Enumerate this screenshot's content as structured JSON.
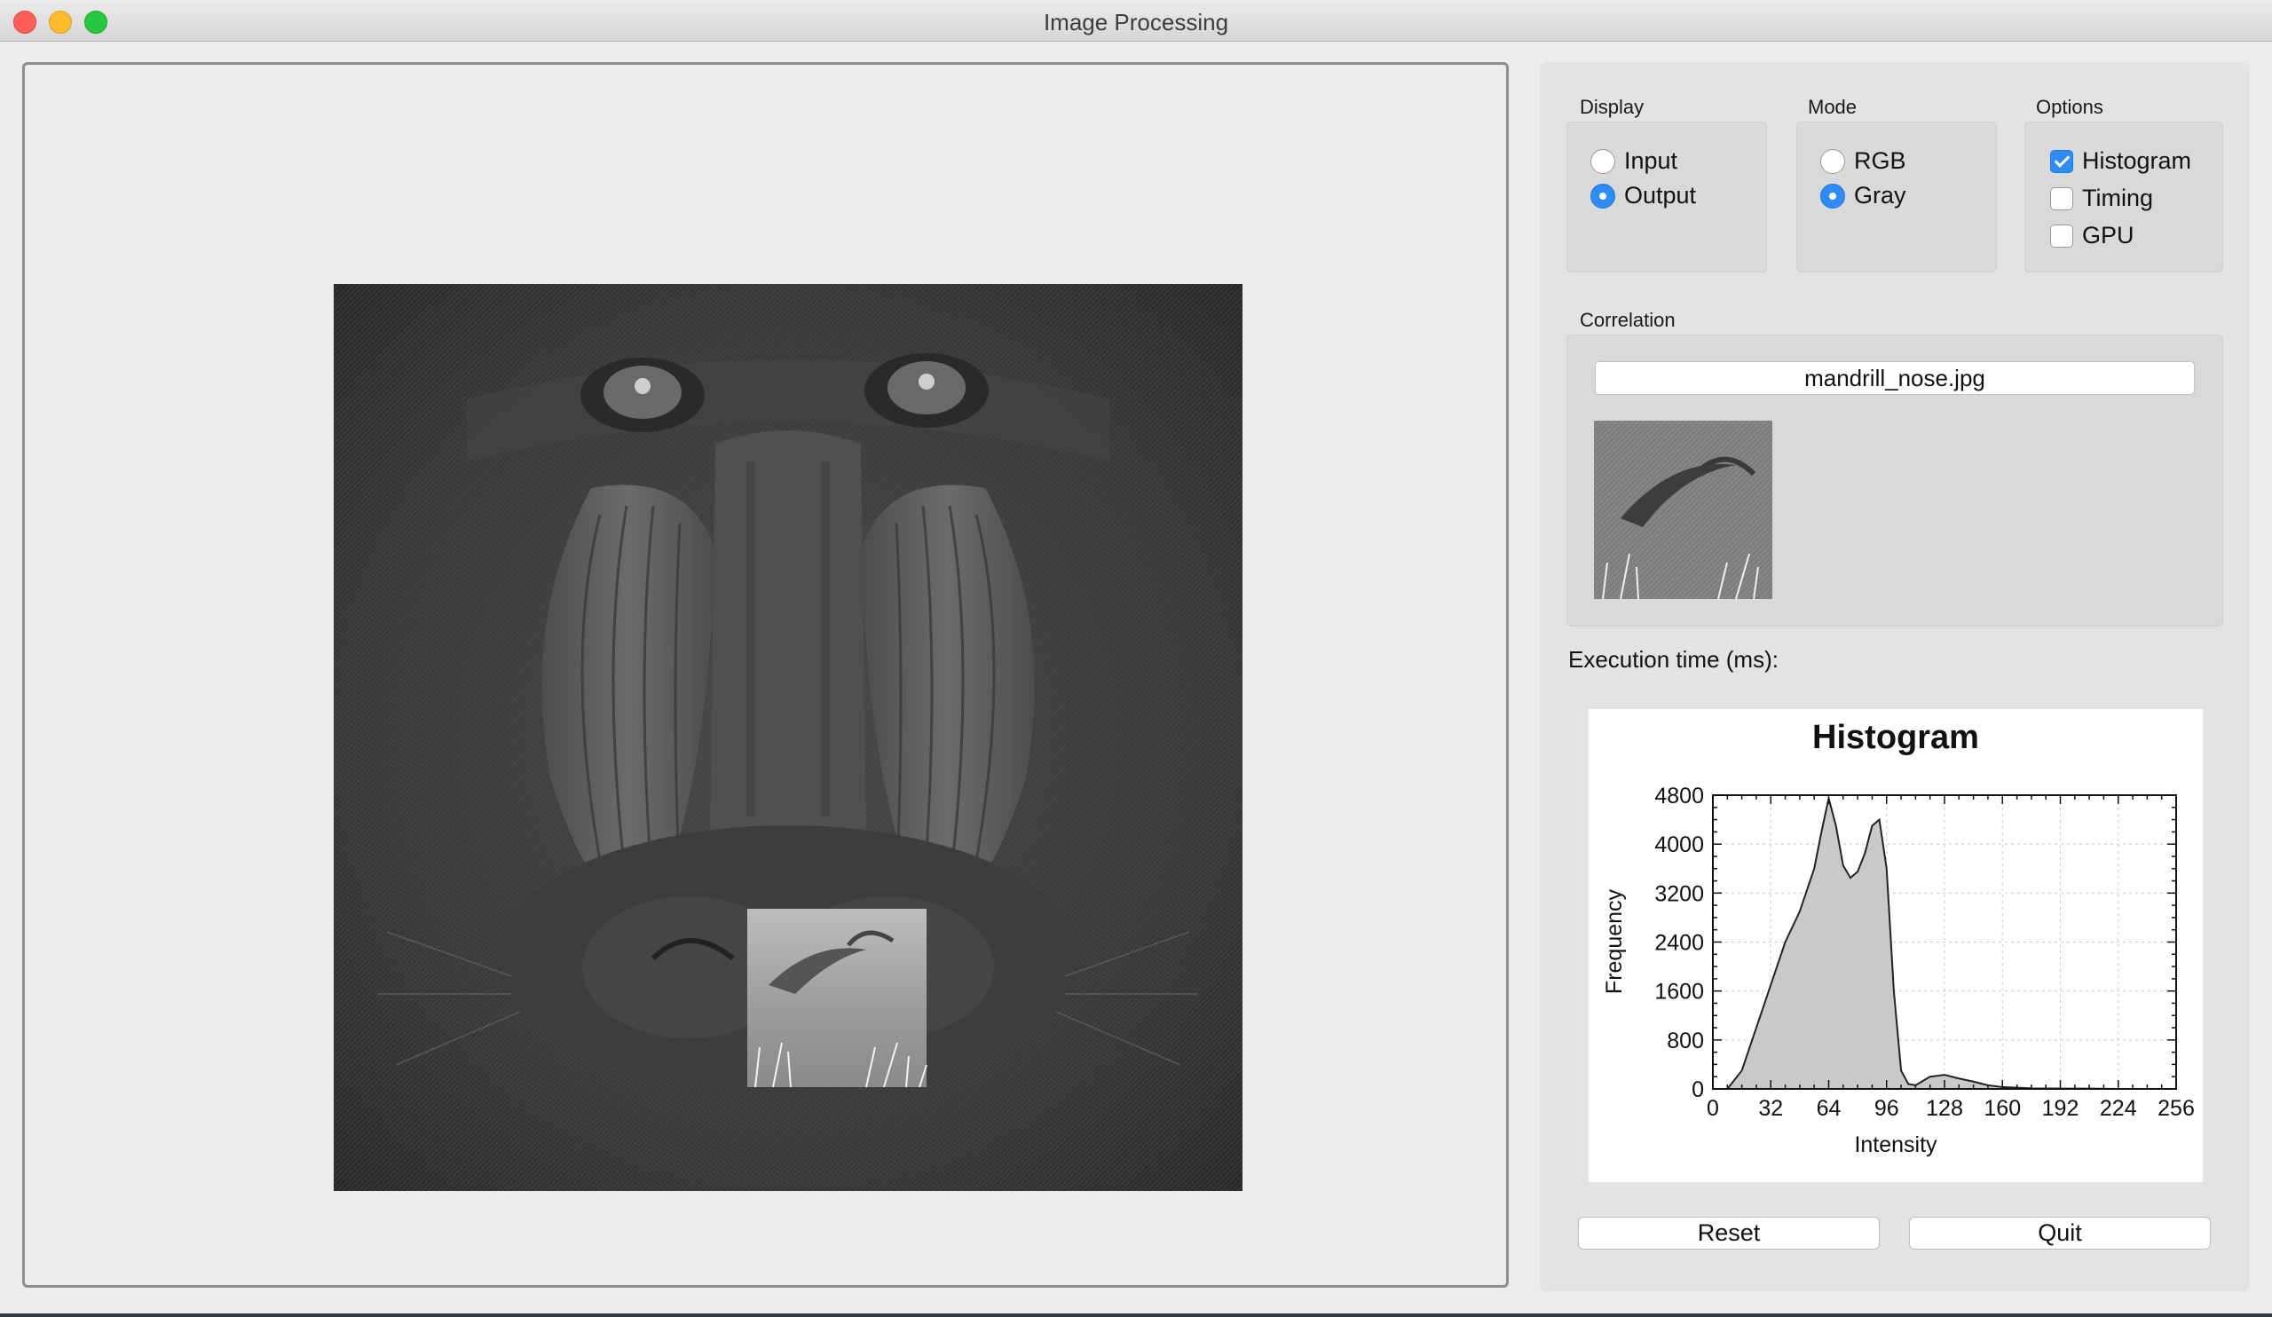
{
  "window": {
    "title": "Image Processing"
  },
  "display": {
    "label": "Display",
    "options": [
      {
        "label": "Input",
        "selected": false
      },
      {
        "label": "Output",
        "selected": true
      }
    ]
  },
  "mode": {
    "label": "Mode",
    "options": [
      {
        "label": "RGB",
        "selected": false
      },
      {
        "label": "Gray",
        "selected": true
      }
    ]
  },
  "options": {
    "label": "Options",
    "items": [
      {
        "label": "Histogram",
        "checked": true
      },
      {
        "label": "Timing",
        "checked": false
      },
      {
        "label": "GPU",
        "checked": false
      }
    ]
  },
  "correlation": {
    "label": "Correlation",
    "file": "mandrill_nose.jpg"
  },
  "execution": {
    "label": "Execution time (ms):"
  },
  "buttons": {
    "reset": "Reset",
    "quit": "Quit"
  },
  "chart_data": {
    "type": "area",
    "title": "Histogram",
    "xlabel": "Intensity",
    "ylabel": "Frequency",
    "xlim": [
      0,
      256
    ],
    "ylim": [
      0,
      4800
    ],
    "xticks": [
      "0",
      "32",
      "64",
      "96",
      "128",
      "160",
      "192",
      "224",
      "256"
    ],
    "yticks": [
      "0",
      "800",
      "1600",
      "2400",
      "3200",
      "4000",
      "4800"
    ],
    "grid": true,
    "x": [
      0,
      8,
      16,
      24,
      32,
      40,
      48,
      56,
      60,
      64,
      68,
      72,
      76,
      80,
      84,
      88,
      92,
      96,
      100,
      104,
      108,
      112,
      120,
      128,
      136,
      144,
      152,
      160,
      176,
      192,
      208,
      224,
      240,
      256
    ],
    "values": [
      0,
      0,
      300,
      1000,
      1700,
      2400,
      2900,
      3600,
      4200,
      4750,
      4300,
      3650,
      3450,
      3550,
      3850,
      4300,
      4400,
      3600,
      1600,
      300,
      80,
      60,
      200,
      230,
      170,
      120,
      60,
      30,
      10,
      5,
      5,
      0,
      0,
      0
    ]
  }
}
